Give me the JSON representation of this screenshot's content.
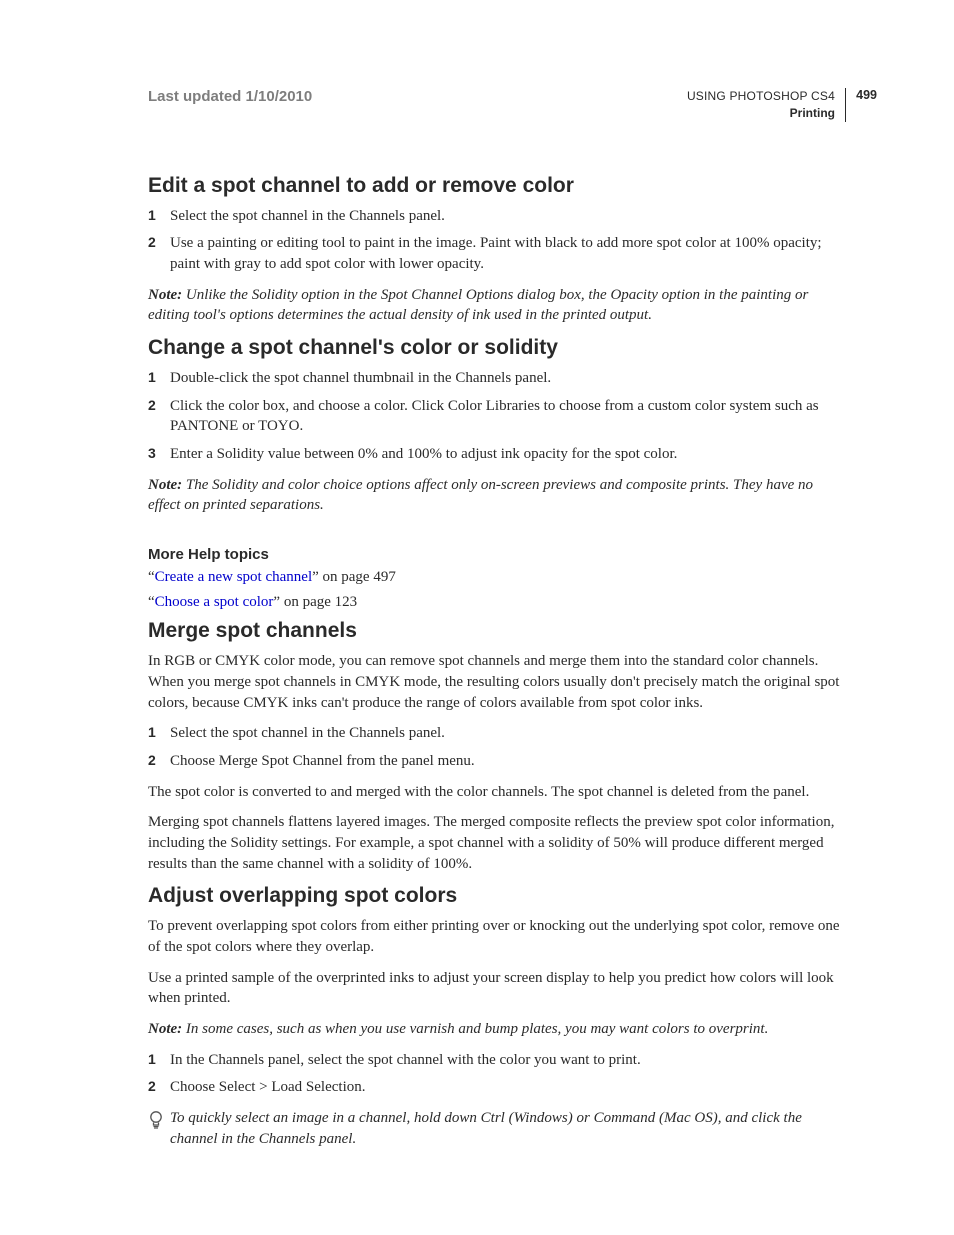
{
  "header": {
    "updated": "Last updated 1/10/2010",
    "doc_title": "USING PHOTOSHOP CS4",
    "doc_section": "Printing",
    "page_num": "499"
  },
  "sec1": {
    "title": "Edit a spot channel to add or remove color",
    "steps": [
      "Select the spot channel in the Channels panel.",
      "Use a painting or editing tool to paint in the image. Paint with black to add more spot color at 100% opacity; paint with gray to add spot color with lower opacity."
    ],
    "note_label": "Note: ",
    "note": "Unlike the Solidity option in the Spot Channel Options dialog box, the Opacity option in the painting or editing tool's options determines the actual density of ink used in the printed output."
  },
  "sec2": {
    "title": "Change a spot channel's color or solidity",
    "steps": [
      "Double-click the spot channel thumbnail in the Channels panel.",
      "Click the color box, and choose a color. Click Color Libraries to choose from a custom color system such as PANTONE or TOYO.",
      "Enter a Solidity value between 0% and 100% to adjust ink opacity for the spot color."
    ],
    "note_label": "Note: ",
    "note": "The Solidity and color choice options affect only on-screen previews and composite prints. They have no effect on printed separations."
  },
  "more_help": {
    "title": "More Help topics",
    "link1_pre": "“",
    "link1_text": "Create a new spot channel",
    "link1_post": "” on page 497",
    "link2_pre": "“",
    "link2_text": "Choose a spot color",
    "link2_post": "” on page 123"
  },
  "sec3": {
    "title": "Merge spot channels",
    "intro": "In RGB or CMYK color mode, you can remove spot channels and merge them into the standard color channels. When you merge spot channels in CMYK mode, the resulting colors usually don't precisely match the original spot colors, because CMYK inks can't produce the range of colors available from spot color inks.",
    "steps": [
      "Select the spot channel in the Channels panel.",
      "Choose Merge Spot Channel from the panel menu."
    ],
    "p1": "The spot color is converted to and merged with the color channels. The spot channel is deleted from the panel.",
    "p2": "Merging spot channels flattens layered images. The merged composite reflects the preview spot color information, including the Solidity settings. For example, a spot channel with a solidity of 50% will produce different merged results than the same channel with a solidity of 100%."
  },
  "sec4": {
    "title": "Adjust overlapping spot colors",
    "p1": "To prevent overlapping spot colors from either printing over or knocking out the underlying spot color, remove one of the spot colors where they overlap.",
    "p2": "Use a printed sample of the overprinted inks to adjust your screen display to help you predict how colors will look when printed.",
    "note_label": "Note: ",
    "note": "In some cases, such as when you use varnish and bump plates, you may want colors to overprint.",
    "steps": [
      "In the Channels panel, select the spot channel with the color you want to print.",
      "Choose Select > Load Selection."
    ],
    "tip": "To quickly select an image in a channel, hold down Ctrl (Windows) or Command (Mac OS), and click the channel in the Channels panel."
  }
}
